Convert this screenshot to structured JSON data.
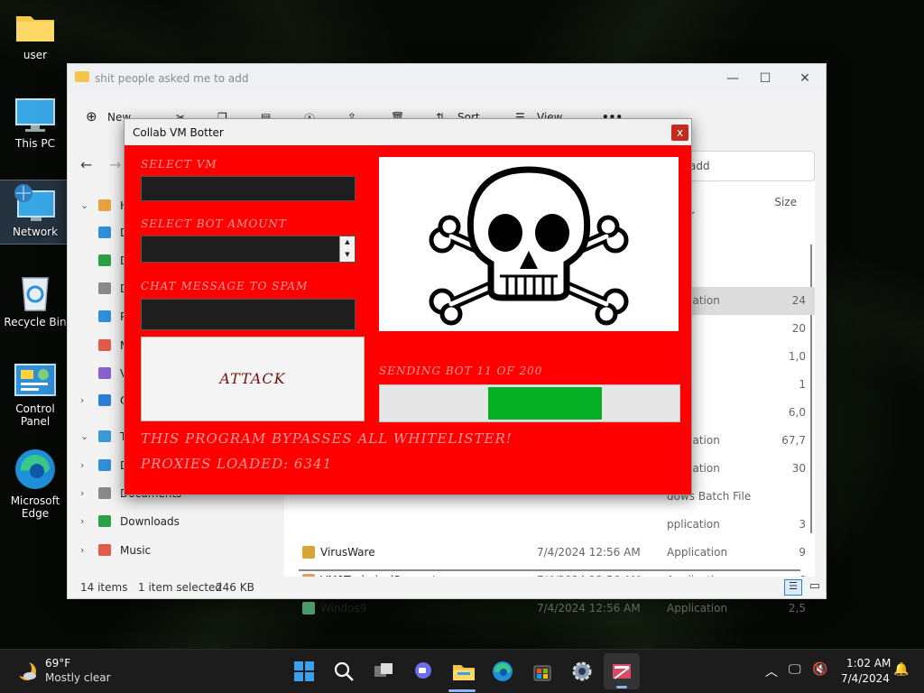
{
  "desktop": {
    "icons": [
      {
        "label": "user"
      },
      {
        "label": "This PC"
      },
      {
        "label": "Network"
      },
      {
        "label": "Recycle Bin"
      },
      {
        "label": "Control Panel"
      },
      {
        "label": "Microsoft Edge"
      }
    ]
  },
  "explorer": {
    "title": "shit people asked me to add",
    "toolbar": {
      "new": "New",
      "sort": "Sort",
      "view": "View",
      "more": "•••"
    },
    "search_placeholder": "add",
    "sidebar": [
      {
        "label": "Ho",
        "chevron": "⌄",
        "color": "#e8a33d"
      },
      {
        "label": "D",
        "chevron": "",
        "color": "#2f8fd8"
      },
      {
        "label": "D",
        "chevron": "",
        "color": "#2aa147"
      },
      {
        "label": "D",
        "chevron": "",
        "color": "#8a8a8a"
      },
      {
        "label": "P",
        "chevron": "",
        "color": "#2f8fd8"
      },
      {
        "label": "M",
        "chevron": "",
        "color": "#e05b4a"
      },
      {
        "label": "V",
        "chevron": "",
        "color": "#8a5fd0"
      },
      {
        "label": "On",
        "chevron": "›",
        "color": "#2b7fd8"
      },
      {
        "label": "Th",
        "chevron": "⌄",
        "color": "#3a9ad9"
      },
      {
        "label": "D",
        "chevron": "›",
        "color": "#2f8fd8"
      },
      {
        "label": "Documents",
        "chevron": "›",
        "color": "#8a8a8a"
      },
      {
        "label": "Downloads",
        "chevron": "›",
        "color": "#2aa147"
      },
      {
        "label": "Music",
        "chevron": "›",
        "color": "#e05b4a"
      }
    ],
    "columns": {
      "type": "older",
      "size": "Size"
    },
    "rows": [
      {
        "name": "",
        "date": "",
        "type": "pplication",
        "size": "24",
        "color": "#7fa4d8",
        "highlight": true
      },
      {
        "name": "",
        "date": "",
        "type": "File",
        "size": "20",
        "color": "#cccccc",
        "highlight": false
      },
      {
        "name": "",
        "date": "",
        "type": "File",
        "size": "1,0",
        "color": "#cccccc",
        "highlight": false
      },
      {
        "name": "",
        "date": "",
        "type": "File",
        "size": "1",
        "color": "#cccccc",
        "highlight": false
      },
      {
        "name": "",
        "date": "",
        "type": "File",
        "size": "6,0",
        "color": "#cccccc",
        "highlight": false
      },
      {
        "name": "",
        "date": "",
        "type": "pplication",
        "size": "67,7",
        "color": "#cccccc",
        "highlight": false
      },
      {
        "name": "",
        "date": "",
        "type": "pplication",
        "size": "30",
        "color": "#cccccc",
        "highlight": false
      },
      {
        "name": "",
        "date": "",
        "type": "dows Batch File",
        "size": "",
        "color": "#cccccc",
        "highlight": false
      },
      {
        "name": "",
        "date": "",
        "type": "pplication",
        "size": "3",
        "color": "#cccccc",
        "highlight": false
      },
      {
        "name": "VirusWare",
        "date": "7/4/2024 12:56 AM",
        "type": "Application",
        "size": "9",
        "color": "#d9a431",
        "highlight": false
      },
      {
        "name": "VM0TechnicalSupport",
        "date": "7/4/2024 12:56 AM",
        "type": "Application",
        "size": "6",
        "color": "#e0a060",
        "highlight": false
      },
      {
        "name": "Windos9",
        "date": "7/4/2024 12:56 AM",
        "type": "Application",
        "size": "2,5",
        "color": "#4a9a6a",
        "highlight": false
      }
    ],
    "status": {
      "items": "14 items",
      "selected": "1 item selected",
      "size": "246 KB"
    }
  },
  "bot": {
    "title": "Collab VM Botter",
    "close": "x",
    "select_vm_label": "SELECT VM",
    "select_bot_label": "SELECT BOT AMOUNT",
    "chat_label": "CHAT MESSAGE TO SPAM",
    "attack_label": "ATTACK",
    "sending_label": "SENDING BOT 11 OF 200",
    "progress": 0.38,
    "bypass_text": "THIS PROGRAM BYPASSES ALL WHITELISTER!",
    "proxies_text": "PROXIES LOADED: 6341"
  },
  "taskbar": {
    "weather_temp": "69°F",
    "weather_desc": "Mostly clear",
    "time": "1:02 AM",
    "date": "7/4/2024"
  }
}
